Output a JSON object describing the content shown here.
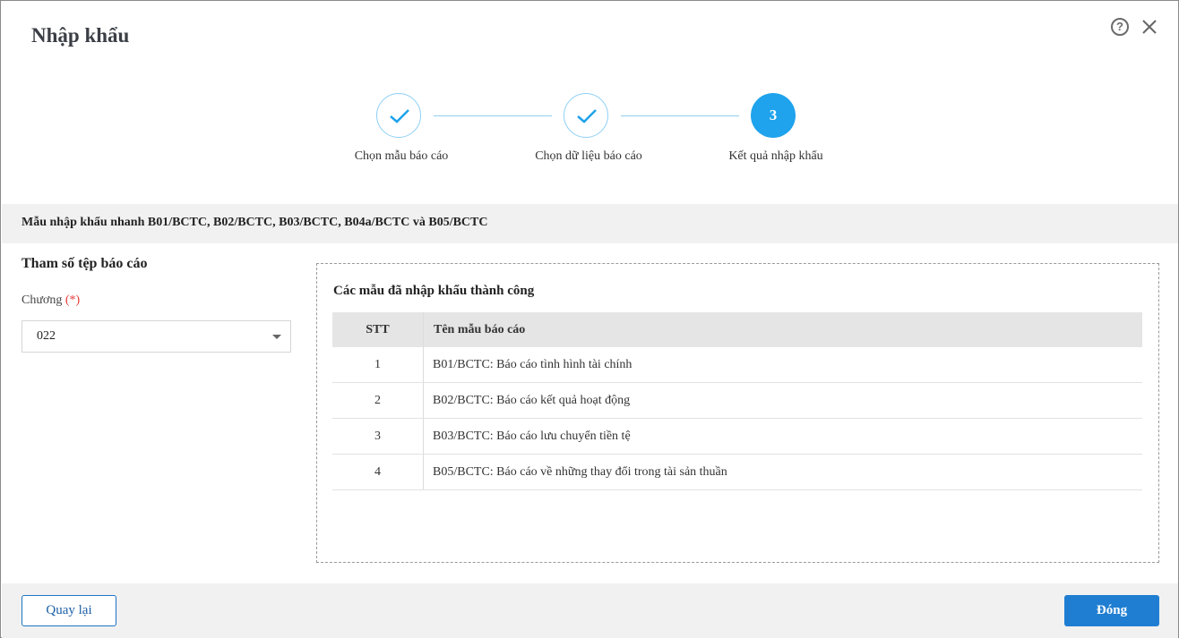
{
  "dialog": {
    "title": "Nhập khẩu"
  },
  "icons": {
    "help": "question-circle-icon",
    "close": "close-icon",
    "check": "check-icon",
    "caret": "caret-down-icon"
  },
  "colors": {
    "accent": "#1ea3ec",
    "primary_button": "#1f7ed1",
    "required": "#e53935",
    "step_line": "#8fcff3"
  },
  "stepper": {
    "steps": [
      {
        "label": "Chọn mẫu báo cáo",
        "state": "done"
      },
      {
        "label": "Chọn dữ liệu báo cáo",
        "state": "done"
      },
      {
        "label": "Kết quả nhập khẩu",
        "state": "active",
        "number": "3"
      }
    ]
  },
  "template_band": {
    "text": "Mẫu nhập khẩu nhanh B01/BCTC, B02/BCTC, B03/BCTC, B04a/BCTC và B05/BCTC"
  },
  "params": {
    "title": "Tham số tệp báo cáo",
    "chapter_label": "Chương",
    "required_mark": "(*)",
    "chapter_value": "022"
  },
  "results": {
    "title": "Các mẫu đã nhập khẩu thành công",
    "columns": {
      "stt": "STT",
      "name": "Tên mẫu báo cáo"
    },
    "rows": [
      {
        "stt": "1",
        "name": "B01/BCTC: Báo cáo tình hình tài chính"
      },
      {
        "stt": "2",
        "name": "B02/BCTC: Báo cáo kết quả hoạt động"
      },
      {
        "stt": "3",
        "name": "B03/BCTC: Báo cáo lưu chuyển tiền tệ"
      },
      {
        "stt": "4",
        "name": "B05/BCTC: Báo cáo về những thay đổi trong tài sản thuần"
      }
    ]
  },
  "footer": {
    "back_label": "Quay lại",
    "close_label": "Đóng"
  }
}
